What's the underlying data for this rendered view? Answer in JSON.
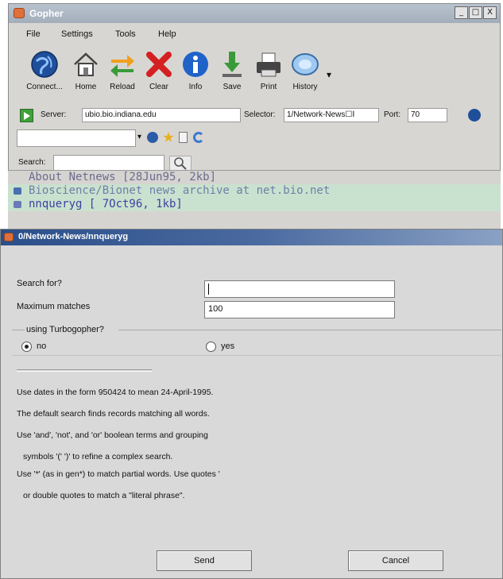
{
  "main_window": {
    "title": "Gopher",
    "window_buttons": [
      "_",
      "□",
      "X"
    ]
  },
  "menu": [
    "File",
    "Settings",
    "Tools",
    "Help"
  ],
  "toolbar": [
    {
      "label": "Connect...",
      "icon": "globe-icon"
    },
    {
      "label": "Home",
      "icon": "home-icon"
    },
    {
      "label": "Reload",
      "icon": "reload-icon"
    },
    {
      "label": "Clear",
      "icon": "clear-icon"
    },
    {
      "label": "Info",
      "icon": "info-icon"
    },
    {
      "label": "Save",
      "icon": "save-icon"
    },
    {
      "label": "Print",
      "icon": "print-icon"
    },
    {
      "label": "History",
      "icon": "history-icon"
    }
  ],
  "connection": {
    "server_label": "Server:",
    "server_value": "ubio.bio.indiana.edu",
    "selector_label": "Selector:",
    "selector_value": "1/Network-News☐Ⅰ",
    "port_label": "Port:",
    "port_value": "70"
  },
  "search": {
    "label": "Search:"
  },
  "gopher_items": [
    {
      "text": "About Netnews  [28Jun95, 2kb]"
    },
    {
      "text": "Bioscience/Bionet news archive at net.bio.net"
    },
    {
      "text": "nnqueryg  [ 7Oct96, 1kb]"
    }
  ],
  "dialog": {
    "title": "0/Network-News/nnqueryg",
    "search_for_label": "Search for?",
    "search_for_value": "",
    "max_matches_label": "Maximum matches",
    "max_matches_value": "100",
    "turbo_label": "using Turbogopher?",
    "radio_no": "no",
    "radio_yes": "yes",
    "help_lines": [
      "Use dates in the form 950424 to mean 24-April-1995.",
      "The default search finds records matching all words.",
      "Use 'and', 'not', and 'or' boolean terms and grouping",
      " symbols '(' ')' to refine a complex search.",
      "Use '*' (as in gen*) to match partial words.  Use quotes '",
      " or double quotes to match a \"literal phrase\"."
    ],
    "send_label": "Send",
    "cancel_label": "Cancel"
  },
  "colors": {
    "dialog_title_bar": "#2b4f8a",
    "selected_row": "#c9e2cf",
    "link_text": "#3f3fa0"
  }
}
